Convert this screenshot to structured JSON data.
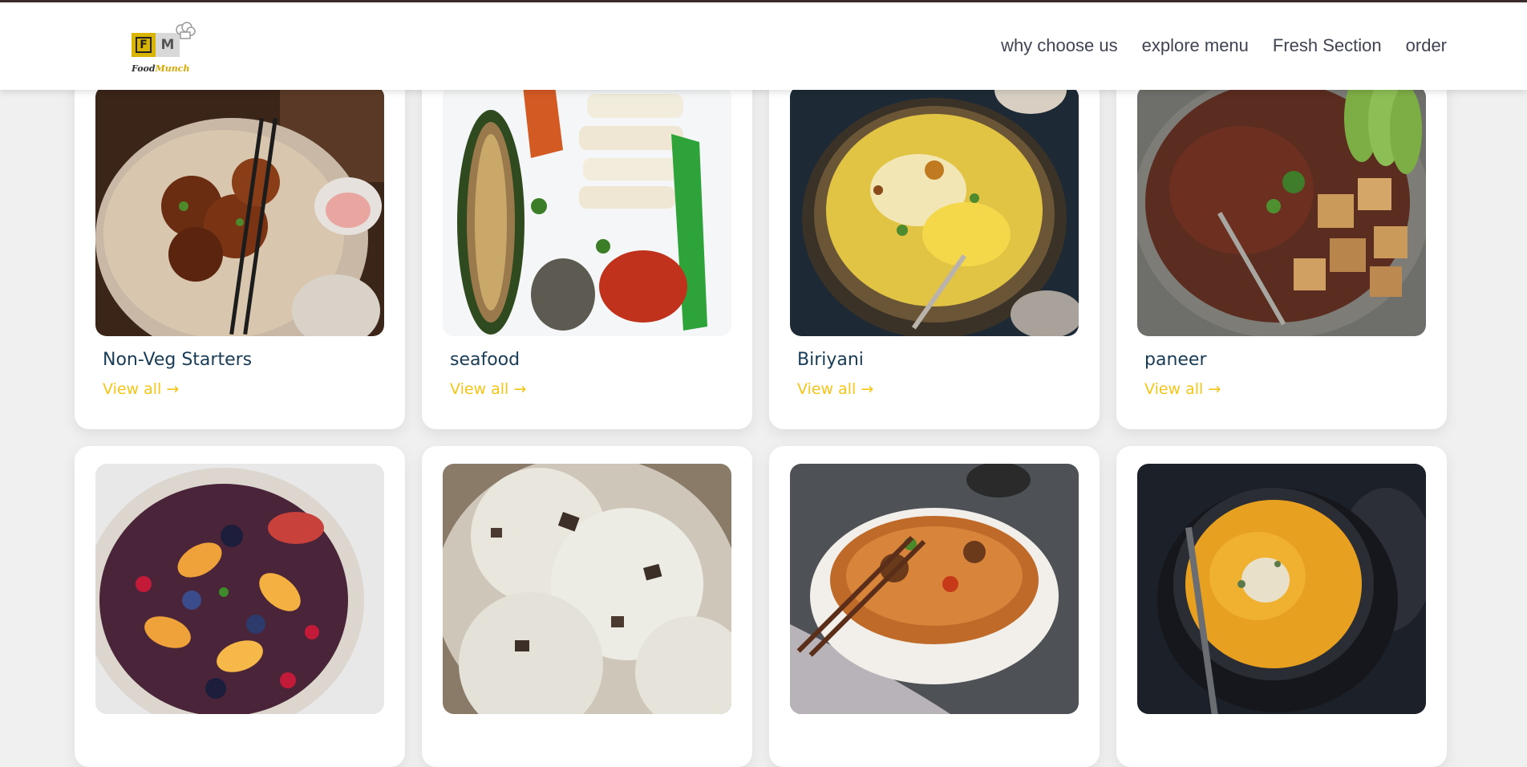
{
  "brand": {
    "logo_left": "F",
    "logo_right": "M",
    "name_part1": "Food",
    "name_part2": "Munch",
    "accent_color": "#f5c518"
  },
  "nav": {
    "links": [
      "why choose us",
      "explore menu",
      "Fresh Section",
      "order"
    ]
  },
  "menu_items": [
    {
      "title": "Non-Veg Starters",
      "link_text": "View all →",
      "image_icon": "fried-chicken-image"
    },
    {
      "title": "seafood",
      "link_text": "View all →",
      "image_icon": "grilled-seafood-image"
    },
    {
      "title": "Biriyani",
      "link_text": "View all →",
      "image_icon": "biriyani-image"
    },
    {
      "title": "paneer",
      "link_text": "View all →",
      "image_icon": "paneer-bowl-image"
    },
    {
      "image_icon": "fruit-bowl-image"
    },
    {
      "image_icon": "ice-cream-image"
    },
    {
      "image_icon": "noodles-image"
    },
    {
      "image_icon": "pumpkin-soup-image"
    }
  ]
}
